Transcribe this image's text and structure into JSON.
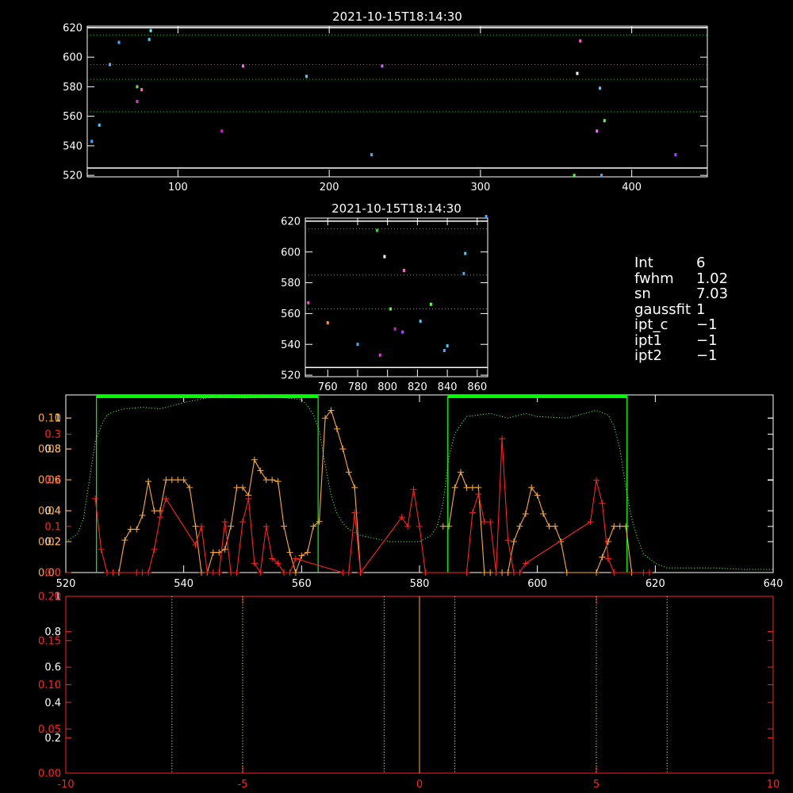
{
  "info_panel": {
    "rows": [
      {
        "key": "Int",
        "value": "6"
      },
      {
        "key": "fwhm",
        "value": "1.02"
      },
      {
        "key": "sn",
        "value": "7.03"
      },
      {
        "key": "gaussfit",
        "value": "1"
      },
      {
        "key": "ipt_c",
        "value": "−1"
      },
      {
        "key": "ipt1",
        "value": "−1"
      },
      {
        "key": "ipt2",
        "value": "−1"
      }
    ]
  },
  "chart_data": [
    {
      "id": "top-scatter",
      "type": "scatter",
      "title": "2021-10-15T18:14:30",
      "xlim": [
        40,
        450
      ],
      "ylim": [
        519,
        621
      ],
      "xticks": [
        100,
        200,
        300,
        400
      ],
      "yticks": [
        520,
        540,
        560,
        580,
        600,
        620
      ],
      "hlines": [
        {
          "y": 620,
          "style": "solid",
          "color": "#ffffff"
        },
        {
          "y": 615,
          "style": "dotted",
          "color": "#22cc22"
        },
        {
          "y": 595,
          "style": "dotted",
          "color": "#cc4422"
        },
        {
          "y": 585,
          "style": "dotted",
          "color": "#22cc22"
        },
        {
          "y": 563,
          "style": "dotted",
          "color": "#22cc22"
        },
        {
          "y": 525,
          "style": "solid",
          "color": "#ffffff"
        }
      ],
      "points": [
        {
          "x": 43,
          "y": 543,
          "color": "#44aaff"
        },
        {
          "x": 48,
          "y": 554,
          "color": "#44ccff"
        },
        {
          "x": 55,
          "y": 595,
          "color": "#66aaff"
        },
        {
          "x": 61,
          "y": 610,
          "color": "#44aaff"
        },
        {
          "x": 73,
          "y": 570,
          "color": "#cc44cc"
        },
        {
          "x": 73,
          "y": 580,
          "color": "#88cc44"
        },
        {
          "x": 76,
          "y": 578,
          "color": "#ff66cc"
        },
        {
          "x": 81,
          "y": 612,
          "color": "#44ccff"
        },
        {
          "x": 82,
          "y": 618,
          "color": "#44ffff"
        },
        {
          "x": 129,
          "y": 550,
          "color": "#cc22cc"
        },
        {
          "x": 143,
          "y": 594,
          "color": "#ff66ff"
        },
        {
          "x": 185,
          "y": 587,
          "color": "#44ccff"
        },
        {
          "x": 228,
          "y": 534,
          "color": "#44aaff"
        },
        {
          "x": 235,
          "y": 594,
          "color": "#cc66ff"
        },
        {
          "x": 362,
          "y": 520,
          "color": "#44ff44"
        },
        {
          "x": 364,
          "y": 589,
          "color": "#ffffff"
        },
        {
          "x": 366,
          "y": 611,
          "color": "#ff66cc"
        },
        {
          "x": 377,
          "y": 550,
          "color": "#ff66ff"
        },
        {
          "x": 379,
          "y": 579,
          "color": "#44ccff"
        },
        {
          "x": 380,
          "y": 520,
          "color": "#44aaff"
        },
        {
          "x": 382,
          "y": 557,
          "color": "#66ff44"
        },
        {
          "x": 429,
          "y": 534,
          "color": "#aa44ff"
        }
      ]
    },
    {
      "id": "zoom-scatter",
      "type": "scatter",
      "title": "2021-10-15T18:14:30",
      "xlim": [
        745,
        867
      ],
      "ylim": [
        519,
        622
      ],
      "xticks": [
        760,
        780,
        800,
        820,
        840,
        860
      ],
      "yticks": [
        520,
        540,
        560,
        580,
        600,
        620
      ],
      "hlines": [
        {
          "y": 620,
          "style": "solid",
          "color": "#ffffff"
        },
        {
          "y": 615,
          "style": "dotted",
          "color": "#22cc22"
        },
        {
          "y": 585,
          "style": "dotted",
          "color": "#22cc22"
        },
        {
          "y": 563,
          "style": "dotted",
          "color": "#22cc22"
        },
        {
          "y": 525,
          "style": "solid",
          "color": "#ffffff"
        }
      ],
      "points": [
        {
          "x": 747,
          "y": 567,
          "color": "#ff44cc"
        },
        {
          "x": 760,
          "y": 554,
          "color": "#ff8844"
        },
        {
          "x": 780,
          "y": 540,
          "color": "#44aaff"
        },
        {
          "x": 793,
          "y": 614,
          "color": "#44cc44"
        },
        {
          "x": 795,
          "y": 533,
          "color": "#cc44cc"
        },
        {
          "x": 798,
          "y": 597,
          "color": "#ffffff"
        },
        {
          "x": 802,
          "y": 563,
          "color": "#44ff44"
        },
        {
          "x": 805,
          "y": 550,
          "color": "#cc22cc"
        },
        {
          "x": 810,
          "y": 548,
          "color": "#aa44ff"
        },
        {
          "x": 811,
          "y": 588,
          "color": "#ff66cc"
        },
        {
          "x": 822,
          "y": 555,
          "color": "#44ccff"
        },
        {
          "x": 829,
          "y": 566,
          "color": "#66ff44"
        },
        {
          "x": 838,
          "y": 536,
          "color": "#44aaff"
        },
        {
          "x": 840,
          "y": 539,
          "color": "#44ccff"
        },
        {
          "x": 851,
          "y": 586,
          "color": "#44aaff"
        },
        {
          "x": 852,
          "y": 599,
          "color": "#44ccff"
        },
        {
          "x": 866,
          "y": 623,
          "color": "#44aaff"
        }
      ]
    },
    {
      "id": "spectrum",
      "type": "line",
      "xlim": [
        520,
        640
      ],
      "xticks": [
        520,
        540,
        560,
        580,
        600,
        620,
        640
      ],
      "axes": [
        {
          "id": "white",
          "color": "#ffffff",
          "ylim": [
            0,
            1.15
          ],
          "yticks": [
            0.2,
            0.4,
            0.6,
            0.8,
            1.0
          ]
        },
        {
          "id": "orange",
          "color": "#ffaa33",
          "ylim": [
            0,
            0.115
          ],
          "yticks": [
            0.0,
            0.02,
            0.04,
            0.06,
            0.08,
            0.1
          ],
          "tick_labels": [
            "0.00",
            "0.02",
            "0.04",
            "0.06",
            "0.08",
            "0.10"
          ]
        },
        {
          "id": "red",
          "color": "#ff2222",
          "ylim": [
            0,
            0.385
          ],
          "yticks": [
            0.0,
            0.1,
            0.2,
            0.3
          ],
          "tick_labels": [
            "0.0",
            "0.1",
            "0.2",
            "0.3"
          ]
        }
      ],
      "bands": [
        {
          "x0": 525.2,
          "x1": 562.8,
          "top": 1.15,
          "color": "#00ff00"
        },
        {
          "x0": 584.8,
          "x1": 615.2,
          "top": 1.15,
          "color": "#00ff00"
        }
      ],
      "series": [
        {
          "id": "throughput",
          "axis": "white",
          "style": "dotted",
          "color": "#66ff66",
          "x": [
            520,
            522,
            523,
            524,
            525,
            526,
            527,
            528,
            530,
            533,
            536,
            540,
            545,
            550,
            555,
            560,
            561,
            562,
            563,
            564,
            565,
            566,
            567,
            568,
            570,
            575,
            580,
            582,
            583,
            584,
            585,
            586,
            588,
            592,
            595,
            598,
            600,
            605,
            610,
            612,
            613,
            614,
            615,
            616,
            617,
            618,
            620,
            622,
            625,
            630,
            635,
            640
          ],
          "y": [
            0.2,
            0.25,
            0.35,
            0.6,
            0.85,
            0.95,
            1.02,
            1.04,
            1.06,
            1.07,
            1.06,
            1.1,
            1.14,
            1.13,
            1.14,
            1.12,
            1.08,
            1.02,
            0.92,
            0.7,
            0.5,
            0.38,
            0.32,
            0.28,
            0.24,
            0.2,
            0.2,
            0.24,
            0.3,
            0.45,
            0.75,
            0.9,
            1.01,
            1.03,
            1.0,
            1.03,
            1.01,
            1.0,
            1.05,
            1.02,
            0.95,
            0.8,
            0.55,
            0.35,
            0.22,
            0.12,
            0.06,
            0.03,
            0.03,
            0.03,
            0.02,
            0.02
          ]
        },
        {
          "id": "orange-profile",
          "axis": "orange",
          "style": "solid",
          "marker": "plus",
          "color": "#ffaa33",
          "x": [
            528,
            529,
            530,
            531,
            532,
            533,
            534,
            535,
            536,
            537,
            538,
            539,
            540,
            541,
            542,
            543,
            544,
            545,
            546,
            547,
            548,
            549,
            550,
            551,
            552,
            553,
            554,
            555,
            556,
            557,
            558,
            559,
            560,
            561,
            562,
            563,
            564,
            565,
            566,
            567,
            568,
            569,
            570,
            584,
            585,
            586,
            587,
            588,
            589,
            590,
            591,
            592,
            593,
            594,
            595,
            596,
            597,
            598,
            599,
            600,
            601,
            602,
            603,
            604,
            605,
            610,
            611,
            612,
            613,
            614,
            615,
            616
          ],
          "y": [
            0.0,
            0.0,
            0.021,
            0.028,
            0.028,
            0.037,
            0.059,
            0.04,
            0.04,
            0.06,
            0.06,
            0.06,
            0.06,
            0.055,
            0.03,
            0.0,
            0.0,
            0.013,
            0.013,
            0.015,
            0.03,
            0.055,
            0.055,
            0.05,
            0.073,
            0.066,
            0.06,
            0.06,
            0.059,
            0.03,
            0.013,
            0.0,
            0.011,
            0.013,
            0.03,
            0.033,
            0.1,
            0.105,
            0.093,
            0.08,
            0.065,
            0.055,
            0.0,
            0.03,
            0.03,
            0.055,
            0.065,
            0.055,
            0.055,
            0.055,
            0.0,
            0.0,
            0.0,
            0.0,
            0.0,
            0.02,
            0.03,
            0.038,
            0.055,
            0.05,
            0.038,
            0.03,
            0.03,
            0.02,
            0.0,
            0.0,
            0.01,
            0.02,
            0.03,
            0.03,
            0.03,
            0.0
          ]
        },
        {
          "id": "red-profile",
          "axis": "red",
          "style": "solid",
          "marker": "plus",
          "color": "#ff2222",
          "x": [
            525,
            526,
            527,
            528,
            532,
            533,
            534,
            535,
            536,
            537,
            542,
            543,
            544,
            545,
            546,
            547,
            548,
            549,
            550,
            551,
            552,
            553,
            554,
            555,
            556,
            557,
            558,
            559,
            567,
            568,
            569,
            570,
            577,
            578,
            579,
            580,
            581,
            588,
            589,
            590,
            591,
            592,
            593,
            594,
            595,
            596,
            597,
            598,
            609,
            610,
            611,
            612,
            613,
            618,
            619
          ],
          "y": [
            0.16,
            0.05,
            0.0,
            0.0,
            0.0,
            0.0,
            0.0,
            0.05,
            0.12,
            0.16,
            0.06,
            0.1,
            0.0,
            0.0,
            0.0,
            0.11,
            0.0,
            0.0,
            0.11,
            0.16,
            0.02,
            0.0,
            0.1,
            0.03,
            0.02,
            0.0,
            0.0,
            0.03,
            0.0,
            0.0,
            0.13,
            0.0,
            0.12,
            0.1,
            0.18,
            0.1,
            0.0,
            0.0,
            0.13,
            0.17,
            0.11,
            0.11,
            0.0,
            0.29,
            0.07,
            0.0,
            0.0,
            0.02,
            0.11,
            0.2,
            0.15,
            0.03,
            0.0,
            0.0,
            0.0
          ]
        }
      ]
    },
    {
      "id": "fit-panel",
      "type": "line",
      "xlim": [
        -10,
        10
      ],
      "xticks": [
        -10,
        -5,
        0,
        5,
        10
      ],
      "axes": [
        {
          "id": "white",
          "color": "#ffffff",
          "ylim": [
            0,
            1.0
          ],
          "yticks": [
            0.2,
            0.4,
            0.6,
            0.8,
            1.0
          ]
        },
        {
          "id": "red",
          "color": "#ff2222",
          "ylim": [
            0,
            0.2
          ],
          "yticks": [
            0.0,
            0.05,
            0.1,
            0.15,
            0.2
          ],
          "tick_labels": [
            "0.00",
            "0.05",
            "0.10",
            "0.15",
            "0.20"
          ]
        }
      ],
      "vlines": [
        {
          "x": -7.0,
          "style": "dotted",
          "color": "#ffffaa"
        },
        {
          "x": -5.0,
          "style": "dotted",
          "color": "#ffffaa"
        },
        {
          "x": -1.0,
          "style": "dotted",
          "color": "#ffffaa"
        },
        {
          "x": 0.0,
          "style": "solid",
          "color": "#ffaa33"
        },
        {
          "x": 1.0,
          "style": "dotted",
          "color": "#ffffaa"
        },
        {
          "x": 5.0,
          "style": "dotted",
          "color": "#ffffaa"
        },
        {
          "x": 7.0,
          "style": "dotted",
          "color": "#ffffaa"
        }
      ]
    }
  ]
}
